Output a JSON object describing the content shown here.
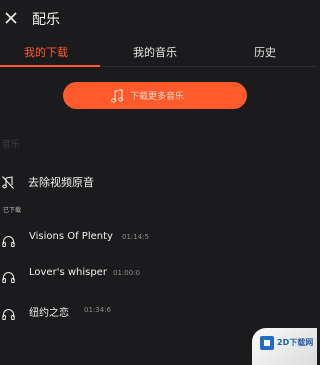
{
  "header": {
    "title": "配乐"
  },
  "tabs": [
    {
      "label": "我的下载",
      "active": true
    },
    {
      "label": "我的音乐",
      "active": false
    },
    {
      "label": "历史",
      "active": false
    }
  ],
  "download_button": {
    "label": "下载更多音乐"
  },
  "faded_label": "音乐",
  "remove_audio": {
    "label": "去除视频原音"
  },
  "section": {
    "label": "已下载"
  },
  "tracks": [
    {
      "name": "Visions Of Plenty",
      "duration": "01:14:5"
    },
    {
      "name": "Lover's whisper",
      "duration": "01:00:0"
    },
    {
      "name": "纽约之恋",
      "duration": "01:34:6"
    }
  ],
  "watermark": {
    "text": "2D下载网"
  },
  "colors": {
    "accent": "#ff5a2c",
    "background": "#1b1b1d"
  }
}
